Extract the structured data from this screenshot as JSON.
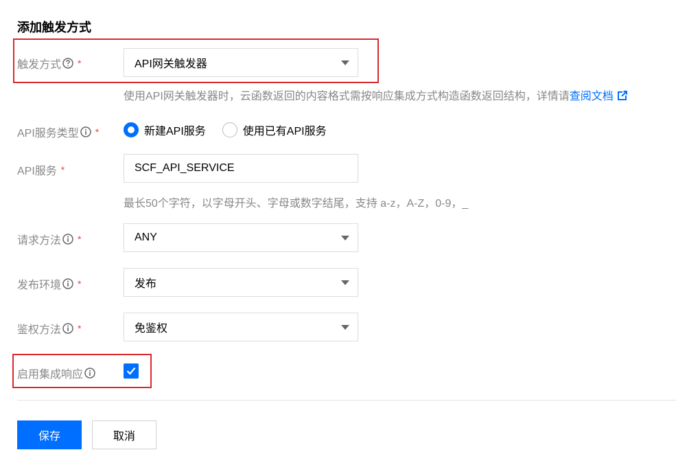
{
  "form_title": "添加触发方式",
  "trigger": {
    "label": "触发方式",
    "required_mark": "*",
    "value": "API网关触发器",
    "help_text": "使用API网关触发器时，云函数返回的内容格式需按响应集成方式构造函数返回结构，详情请",
    "help_link": "查阅文档"
  },
  "api_service_type": {
    "label": "API服务类型",
    "required_mark": "*",
    "options": [
      "新建API服务",
      "使用已有API服务"
    ],
    "selected": "新建API服务"
  },
  "api_service": {
    "label": "API服务",
    "required_mark": "*",
    "value": "SCF_API_SERVICE",
    "help_text": "最长50个字符，以字母开头、字母或数字结尾，支持 a-z，A-Z，0-9，_"
  },
  "request_method": {
    "label": "请求方法",
    "required_mark": "*",
    "value": "ANY"
  },
  "publish_env": {
    "label": "发布环境",
    "required_mark": "*",
    "value": "发布"
  },
  "auth_method": {
    "label": "鉴权方法",
    "required_mark": "*",
    "value": "免鉴权"
  },
  "integration_response": {
    "label": "启用集成响应",
    "checked": true
  },
  "buttons": {
    "save": "保存",
    "cancel": "取消"
  },
  "colors": {
    "primary": "#006eff",
    "highlight_box": "#d9282c",
    "required": "#e54545"
  }
}
